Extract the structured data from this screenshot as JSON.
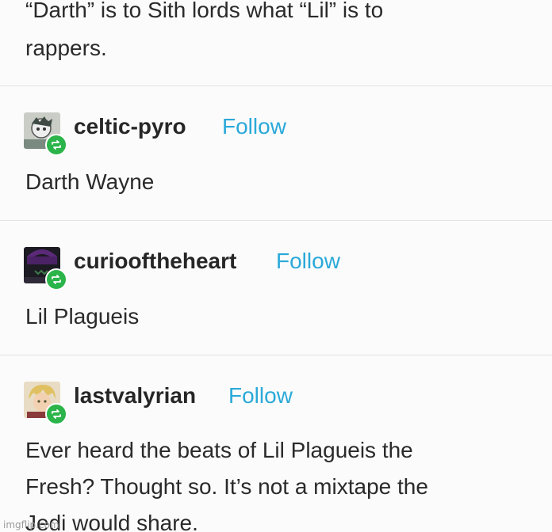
{
  "op_post": {
    "line1": "“Darth” is to Sith lords what “Lil” is to",
    "line2": "rappers."
  },
  "replies": [
    {
      "username": "celtic-pyro",
      "follow_label": "Follow",
      "text_lines": [
        "Darth Wayne"
      ]
    },
    {
      "username": "curiooftheheart",
      "follow_label": "Follow",
      "text_lines": [
        "Lil Plagueis"
      ]
    },
    {
      "username": "lastvalyrian",
      "follow_label": "Follow",
      "text_lines": [
        "Ever heard the beats of Lil Plagueis the",
        "Fresh? Thought so. It’s not a mixtape the",
        "Jedi would share."
      ]
    }
  ],
  "watermark": "imgflip.com",
  "colors": {
    "follow": "#2aa9d9",
    "reblog_badge": "#2bb44a"
  },
  "icons": [
    "reblog-icon"
  ]
}
